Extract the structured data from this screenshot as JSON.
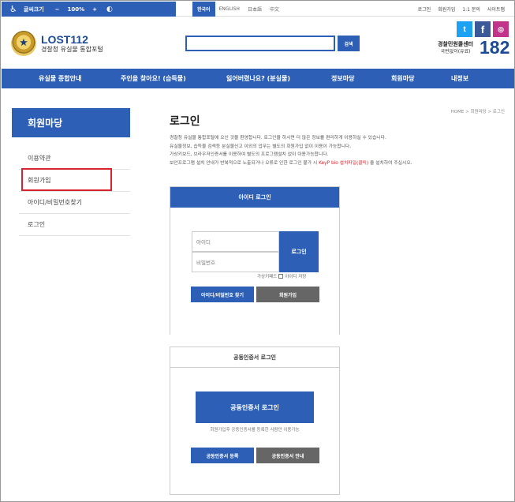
{
  "accessibility": {
    "label": "글씨크기",
    "minus": "−",
    "zoom": "100%",
    "plus": "+"
  },
  "languages": [
    "한국어",
    "ENGLISH",
    "日本語",
    "中文"
  ],
  "top_links": [
    "로그인",
    "회원가입",
    "1:1 문의",
    "사이트맵"
  ],
  "logo": {
    "title": "LOST112",
    "subtitle": "경찰청 유실물 통합포털"
  },
  "search": {
    "button": "검색",
    "value": ""
  },
  "social": {
    "twitter": "t",
    "facebook": "f",
    "instagram": "◎"
  },
  "callcenter": {
    "name": "경찰민원콜센터",
    "sub": "국번없이(유료)",
    "number": "182"
  },
  "nav": [
    "유실물 종합안내",
    "주인을 찾아요! (습득물)",
    "잃어버렸나요? (분실물)",
    "정보마당",
    "회원마당",
    "내정보"
  ],
  "sidebar": {
    "title": "회원마당",
    "items": [
      "이용약관",
      "회원가입",
      "아이디/비밀번호찾기",
      "로그인"
    ]
  },
  "breadcrumb": "HOME > 회원마당 > 로그인",
  "page_title": "로그인",
  "intro": {
    "line1": "경찰청 유실물 통합포털에 오신 것을 환영합니다. 로그인을 하시면 더 많은 정보를 편리하게 이용하실 수 있습니다.",
    "line2": "유실물정보, 습득물 검색등 분실물신고 이외의 업무는 별도의 회원가입 없이 이용이 가능합니다.",
    "line3": "가상키보드, 브라우저인증서를 이용하여 별도의 프로그램설치 없이 이용가능합니다.",
    "line4_pre": "보안프로그램 설치 안내가 반복적으로 노출되거나 오류로 인한 로그인 불가 시 ",
    "line4_red": "KeyP bio 설치파일(클릭)",
    "line4_post": " 을 설치하여 주십시오."
  },
  "id_login": {
    "title": "아이디 로그인",
    "id_placeholder": "아이디",
    "pw_placeholder": "비밀번호",
    "login_button": "로그인",
    "vkbd_label": "가상키패드",
    "save_id_label": "아이디 저장",
    "find_button": "아이디/비밀번호 찾기",
    "join_button": "회원가입"
  },
  "cert_login": {
    "title": "공동인증서 로그인",
    "login_button": "공동인증서 로그인",
    "note": "회원가입후 공동인증서를 등록한 사람만 이용가능",
    "register_button": "공동인증서 등록",
    "guide_button": "공동인증서 안내"
  },
  "colors": {
    "primary": "#2c5fb5",
    "gray_button": "#666666",
    "highlight": "#d9232d"
  }
}
